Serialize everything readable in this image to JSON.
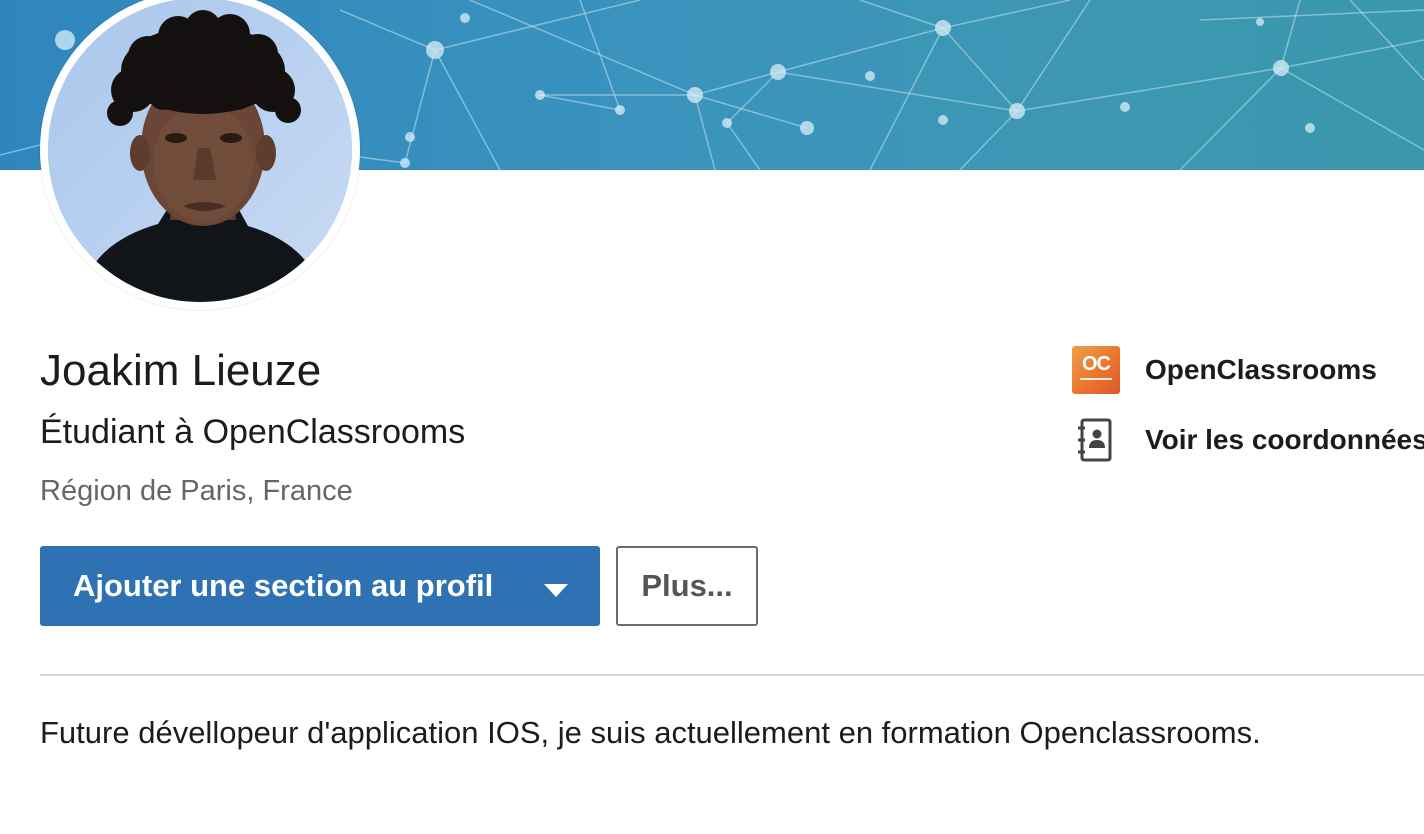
{
  "colors": {
    "banner": "#3a93bd",
    "primary_button": "#2e72b3",
    "text": "#1c1c1c",
    "muted_text": "#666666",
    "logo_orange": "#e7762f"
  },
  "profile": {
    "name": "Joakim Lieuze",
    "headline": "Étudiant à OpenClassrooms",
    "location": "Région de Paris, France",
    "summary": "Future dévellopeur d'application IOS, je suis actuellement en formation Openclassrooms."
  },
  "actions": {
    "add_section_label": "Ajouter une section au profil",
    "add_section_icon": "caret-down-icon",
    "more_label": "Plus..."
  },
  "sidebar": {
    "company": {
      "label": "OpenClassrooms",
      "logo_text": "OC",
      "icon": "openclassrooms-logo"
    },
    "contact": {
      "label": "Voir les coordonnées",
      "icon": "contact-book-icon"
    }
  }
}
